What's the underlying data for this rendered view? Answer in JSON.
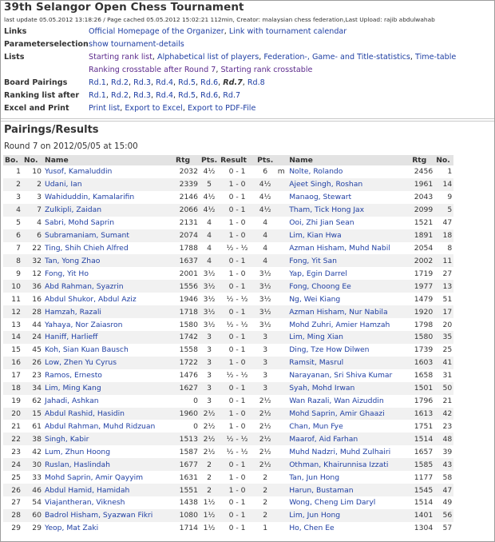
{
  "header": {
    "title": "39th Selangor Open Chess Tournament",
    "update_line": "last update 05.05.2012 13:18:26 / Page cached 05.05.2012 15:02:21 112min, Creator: malaysian chess federation,Last Upload: rajib abdulwahab"
  },
  "info_rows": {
    "links": {
      "label": "Links",
      "items": [
        "Official Homepage of the Organizer",
        "Link with tournament calendar"
      ]
    },
    "param": {
      "label": "Parameterselection",
      "items": [
        "show tournament-details"
      ]
    },
    "lists": {
      "label": "Lists",
      "line1": [
        "Starting rank list",
        "Alphabetical list of players",
        "Federation-, Game- and Title-statistics",
        "Time-table"
      ],
      "line2": [
        "Ranking crosstable after Round 7",
        "Starting rank crosstable"
      ]
    },
    "board_pairings": {
      "label": "Board Pairings",
      "items": [
        "Rd.1",
        "Rd.2",
        "Rd.3",
        "Rd.4",
        "Rd.5",
        "Rd.6",
        "Rd.7",
        "Rd.8"
      ],
      "current": "Rd.7"
    },
    "ranking": {
      "label": "Ranking list after",
      "items": [
        "Rd.1",
        "Rd.2",
        "Rd.3",
        "Rd.4",
        "Rd.5",
        "Rd.6",
        "Rd.7"
      ]
    },
    "excel": {
      "label": "Excel and Print",
      "items": [
        "Print list",
        "Export to Excel",
        "Export to PDF-File"
      ]
    }
  },
  "section": {
    "title": "Pairings/Results",
    "round_info": "Round 7 on 2012/05/05 at 15:00"
  },
  "table": {
    "headers": [
      "Bo.",
      "No.",
      "Name",
      "Rtg",
      "Pts.",
      "Result",
      "Pts.",
      "",
      "Name",
      "Rtg",
      "No."
    ],
    "rows": [
      [
        "1",
        "10",
        "Yusof, Kamaluddin",
        "2032",
        "4½",
        "0 - 1",
        "6",
        "m",
        "Nolte, Rolando",
        "2456",
        "1"
      ],
      [
        "2",
        "2",
        "Udani, Ian",
        "2339",
        "5",
        "1 - 0",
        "4½",
        "",
        "Ajeet Singh, Roshan",
        "1961",
        "14"
      ],
      [
        "3",
        "3",
        "Wahiduddin, Kamalarifin",
        "2146",
        "4½",
        "0 - 1",
        "4½",
        "",
        "Manaog, Stewart",
        "2043",
        "9"
      ],
      [
        "4",
        "7",
        "Zulkipli, Zaidan",
        "2066",
        "4½",
        "0 - 1",
        "4½",
        "",
        "Tham, Tick Hong Jax",
        "2099",
        "5"
      ],
      [
        "5",
        "4",
        "Sabri, Mohd Saprin",
        "2131",
        "4",
        "1 - 0",
        "4",
        "",
        "Ooi, Zhi Jian Sean",
        "1521",
        "47"
      ],
      [
        "6",
        "6",
        "Subramaniam, Sumant",
        "2074",
        "4",
        "1 - 0",
        "4",
        "",
        "Lim, Kian Hwa",
        "1891",
        "18"
      ],
      [
        "7",
        "22",
        "Ting, Shih Chieh Alfred",
        "1788",
        "4",
        "½ - ½",
        "4",
        "",
        "Azman Hisham, Muhd Nabil",
        "2054",
        "8"
      ],
      [
        "8",
        "32",
        "Tan, Yong Zhao",
        "1637",
        "4",
        "0 - 1",
        "4",
        "",
        "Fong, Yit San",
        "2002",
        "11"
      ],
      [
        "9",
        "12",
        "Fong, Yit Ho",
        "2001",
        "3½",
        "1 - 0",
        "3½",
        "",
        "Yap, Egin Darrel",
        "1719",
        "27"
      ],
      [
        "10",
        "36",
        "Abd Rahman, Syazrin",
        "1556",
        "3½",
        "0 - 1",
        "3½",
        "",
        "Fong, Choong Ee",
        "1977",
        "13"
      ],
      [
        "11",
        "16",
        "Abdul Shukor, Abdul Aziz",
        "1946",
        "3½",
        "½ - ½",
        "3½",
        "",
        "Ng, Wei Kiang",
        "1479",
        "51"
      ],
      [
        "12",
        "28",
        "Hamzah, Razali",
        "1718",
        "3½",
        "0 - 1",
        "3½",
        "",
        "Azman Hisham, Nur Nabila",
        "1920",
        "17"
      ],
      [
        "13",
        "44",
        "Yahaya, Nor Zaiasron",
        "1580",
        "3½",
        "½ - ½",
        "3½",
        "",
        "Mohd Zuhri, Amier Hamzah",
        "1798",
        "20"
      ],
      [
        "14",
        "24",
        "Haniff, Harlieff",
        "1742",
        "3",
        "0 - 1",
        "3",
        "",
        "Lim, Ming Xian",
        "1580",
        "35"
      ],
      [
        "15",
        "45",
        "Koh, Sian Kuan Bausch",
        "1558",
        "3",
        "0 - 1",
        "3",
        "",
        "Ding, Tze How Dilwen",
        "1739",
        "25"
      ],
      [
        "16",
        "26",
        "Low, Zhen Yu Cyrus",
        "1722",
        "3",
        "1 - 0",
        "3",
        "",
        "Ramsit, Masrul",
        "1603",
        "41"
      ],
      [
        "17",
        "23",
        "Ramos, Ernesto",
        "1476",
        "3",
        "½ - ½",
        "3",
        "",
        "Narayanan, Sri Shiva Kumar",
        "1658",
        "31"
      ],
      [
        "18",
        "34",
        "Lim, Ming Kang",
        "1627",
        "3",
        "0 - 1",
        "3",
        "",
        "Syah, Mohd Irwan",
        "1501",
        "50"
      ],
      [
        "19",
        "62",
        "Jahadi, Ashkan",
        "0",
        "3",
        "0 - 1",
        "2½",
        "",
        "Wan Razali, Wan Aizuddin",
        "1796",
        "21"
      ],
      [
        "20",
        "15",
        "Abdul Rashid, Hasidin",
        "1960",
        "2½",
        "1 - 0",
        "2½",
        "",
        "Mohd Saprin, Amir Ghaazi",
        "1613",
        "42"
      ],
      [
        "21",
        "61",
        "Abdul Rahman, Muhd Ridzuan",
        "0",
        "2½",
        "1 - 0",
        "2½",
        "",
        "Chan, Mun Fye",
        "1751",
        "23"
      ],
      [
        "22",
        "38",
        "Singh, Kabir",
        "1513",
        "2½",
        "½ - ½",
        "2½",
        "",
        "Maarof, Aid Farhan",
        "1514",
        "48"
      ],
      [
        "23",
        "42",
        "Lum, Zhun Hoong",
        "1587",
        "2½",
        "½ - ½",
        "2½",
        "",
        "Muhd Nadzri, Muhd Zulhairi",
        "1657",
        "39"
      ],
      [
        "24",
        "30",
        "Ruslan, Haslindah",
        "1677",
        "2",
        "0 - 1",
        "2½",
        "",
        "Othman, Khairunnisa Izzati",
        "1585",
        "43"
      ],
      [
        "25",
        "33",
        "Mohd Saprin, Amir Qayyim",
        "1631",
        "2",
        "1 - 0",
        "2",
        "",
        "Tan, Jun Hong",
        "1177",
        "58"
      ],
      [
        "26",
        "46",
        "Abdul Hamid, Hamidah",
        "1551",
        "2",
        "1 - 0",
        "2",
        "",
        "Harun, Bustaman",
        "1545",
        "47"
      ],
      [
        "27",
        "54",
        "Viajantheran, Viknesh",
        "1438",
        "1½",
        "0 - 1",
        "2",
        "",
        "Wong, Cheng Lim Daryl",
        "1514",
        "49"
      ],
      [
        "28",
        "60",
        "Badrol Hisham, Syazwan Fikri",
        "1080",
        "1½",
        "0 - 1",
        "2",
        "",
        "Lim, Jun Hong",
        "1401",
        "56"
      ],
      [
        "29",
        "29",
        "Yeop, Mat Zaki",
        "1714",
        "1½",
        "0 - 1",
        "1",
        "",
        "Ho, Chen Ee",
        "1304",
        "57"
      ]
    ]
  }
}
